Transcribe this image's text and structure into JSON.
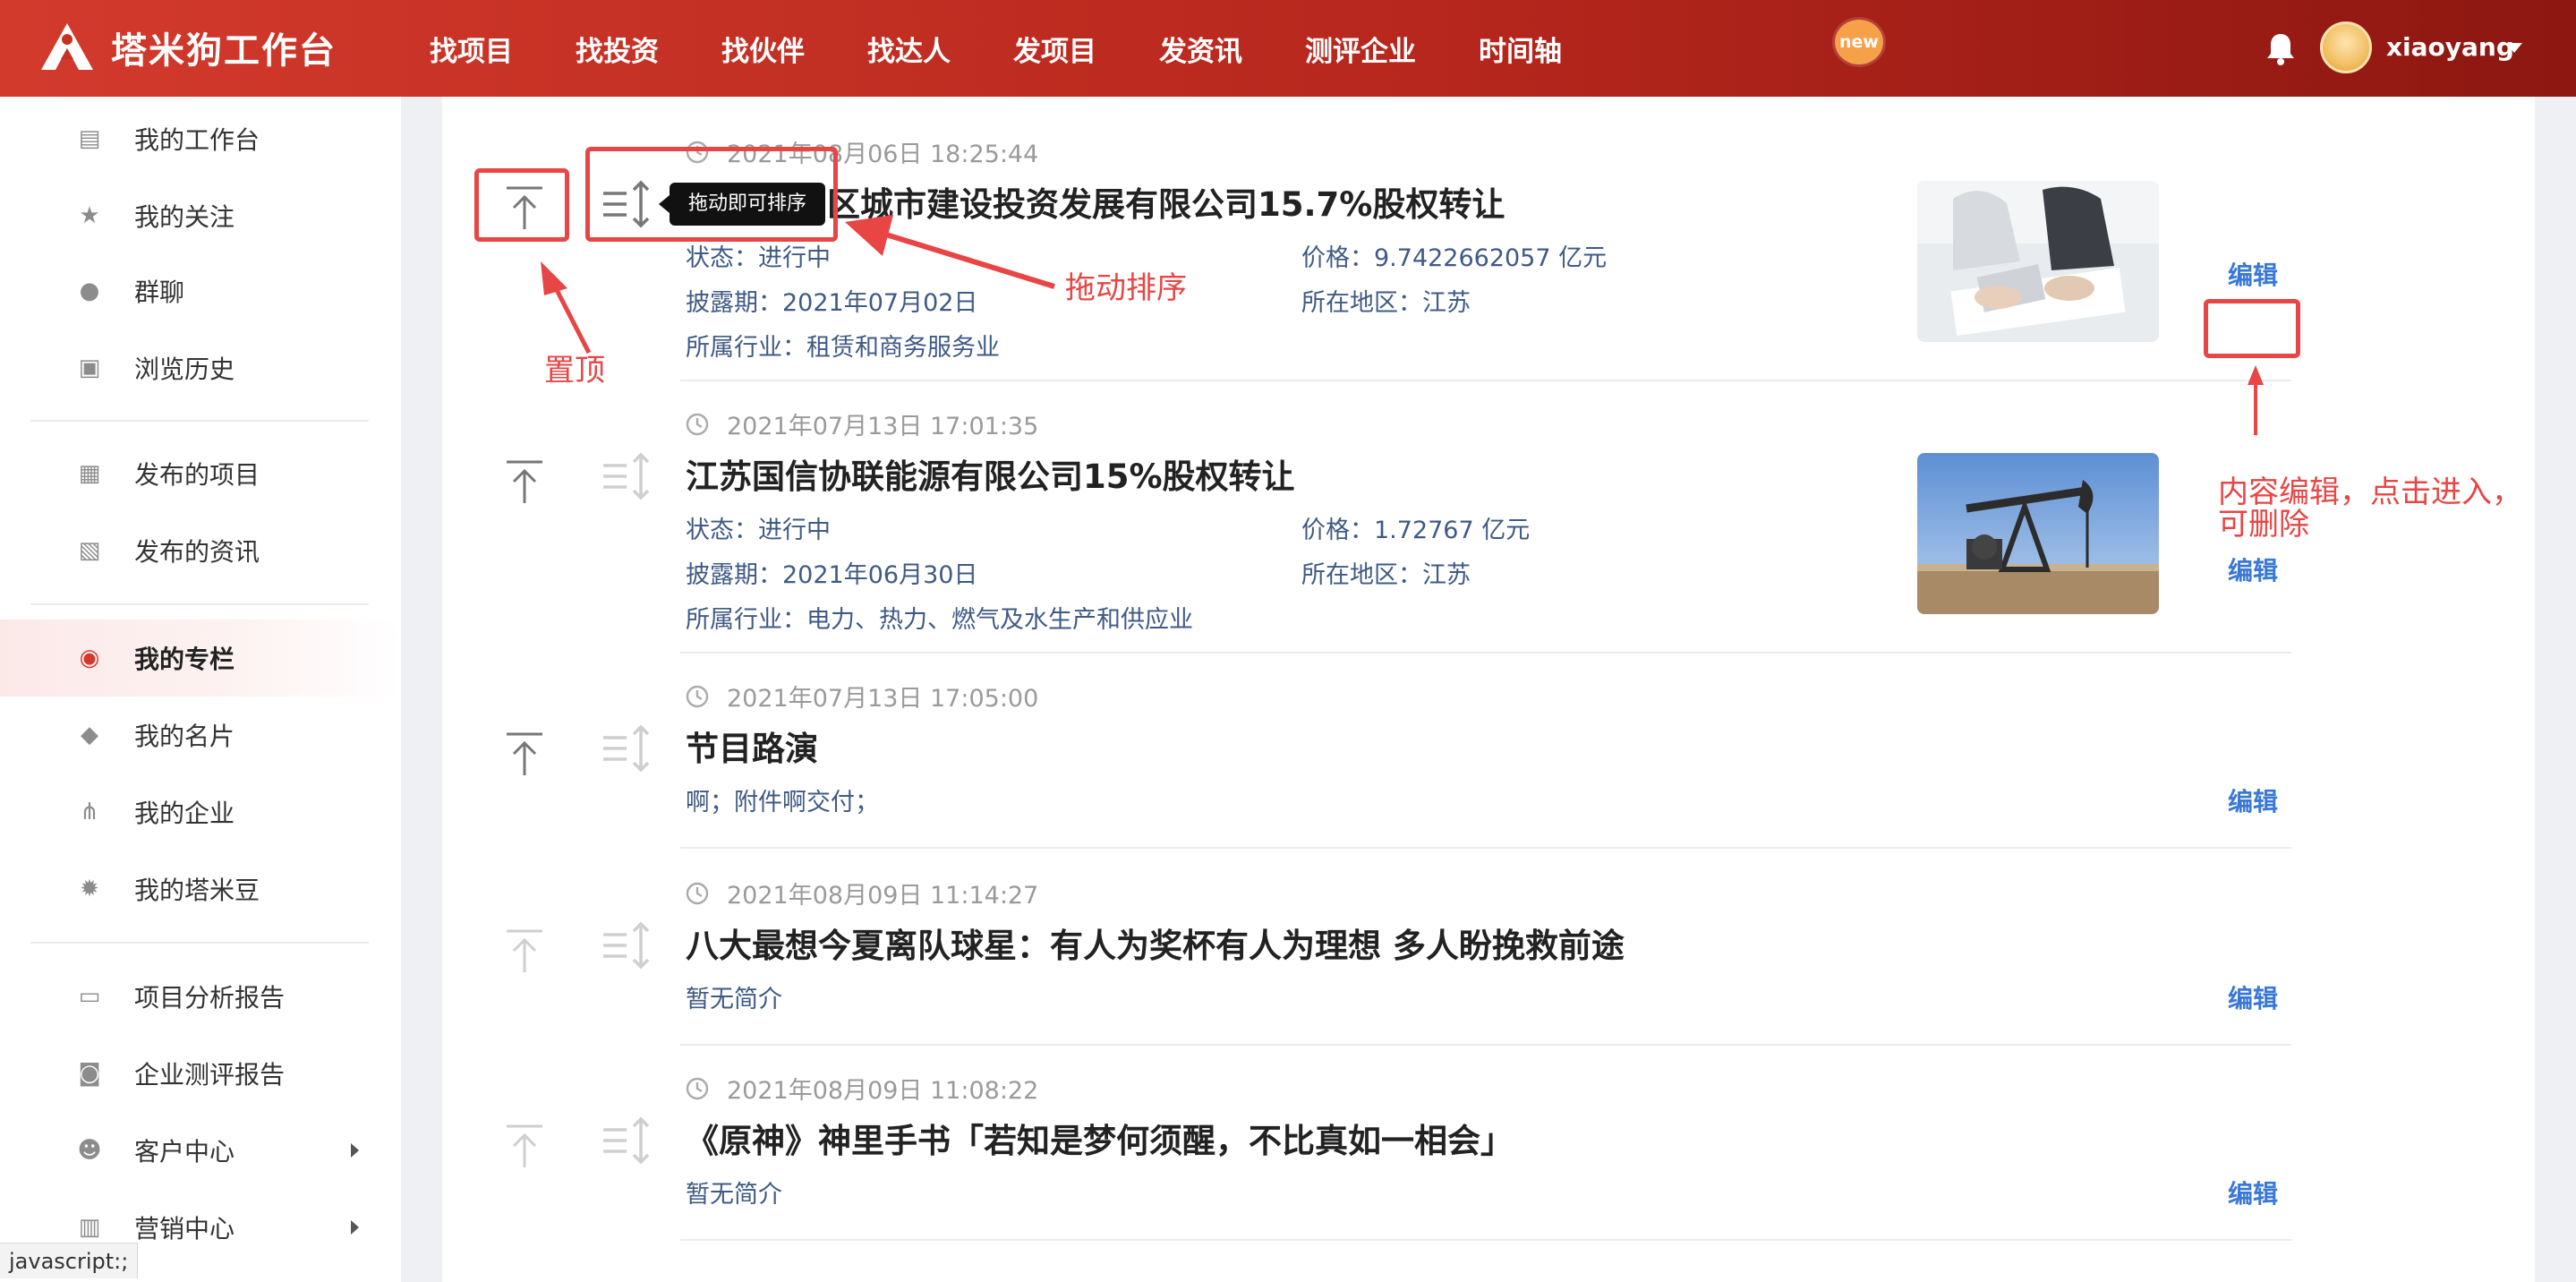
{
  "header": {
    "logo_text": "塔米狗工作台",
    "nav": [
      "找项目",
      "找投资",
      "找伙伴",
      "找达人",
      "发项目",
      "发资讯",
      "测评企业",
      "时间轴"
    ],
    "new_badge": "new",
    "username": "xiaoyang",
    "brand_color": "#c8301f"
  },
  "sidebar": {
    "groups": [
      [
        {
          "label": "我的工作台",
          "icon": "chart-icon"
        },
        {
          "label": "我的关注",
          "icon": "star-icon"
        },
        {
          "label": "群聊",
          "icon": "chat-icon"
        },
        {
          "label": "浏览历史",
          "icon": "history-icon"
        }
      ],
      [
        {
          "label": "发布的项目",
          "icon": "folder-icon"
        },
        {
          "label": "发布的资讯",
          "icon": "news-icon"
        }
      ],
      [
        {
          "label": "我的专栏",
          "icon": "column-icon",
          "active": true
        },
        {
          "label": "我的名片",
          "icon": "tag-icon"
        },
        {
          "label": "我的企业",
          "icon": "org-icon"
        },
        {
          "label": "我的塔米豆",
          "icon": "bean-icon"
        }
      ],
      [
        {
          "label": "项目分析报告",
          "icon": "report-icon"
        },
        {
          "label": "企业测评报告",
          "icon": "search-report-icon"
        },
        {
          "label": "客户中心",
          "icon": "customer-icon",
          "expandable": true
        },
        {
          "label": "营销中心",
          "icon": "marketing-icon",
          "expandable": true
        }
      ]
    ]
  },
  "status_bar": "javascript:;",
  "tooltip": "拖动即可排序",
  "annotations": {
    "pin": "置顶",
    "drag": "拖动排序",
    "edit": "内容编辑，点击进入，",
    "edit_line2": "可删除",
    "color": "#e84545"
  },
  "edit_label": "编辑",
  "items": [
    {
      "time": "2021年08月06日 18:25:44",
      "title": "区城市建设投资发展有限公司15.7%股权转让",
      "status": "状态：进行中",
      "price": "价格：9.7422662057 亿元",
      "disclosure": "披露期：2021年07月02日",
      "region": "所在地区：江苏",
      "industry": "所属行业：租赁和商务服务业",
      "thumb": "business-meeting-photo"
    },
    {
      "time": "2021年07月13日 17:01:35",
      "title": "江苏国信协联能源有限公司15%股权转让",
      "status": "状态：进行中",
      "price": "价格：1.72767 亿元",
      "disclosure": "披露期：2021年06月30日",
      "region": "所在地区：江苏",
      "industry": "所属行业：电力、热力、燃气及水生产和供应业",
      "thumb": "oil-pump-photo"
    },
    {
      "time": "2021年07月13日 17:05:00",
      "title": "节目路演",
      "summary": "啊；附件啊交付；"
    },
    {
      "time": "2021年08月09日 11:14:27",
      "title": "八大最想今夏离队球星：有人为奖杯有人为理想 多人盼挽救前途",
      "summary": "暂无简介"
    },
    {
      "time": "2021年08月09日 11:08:22",
      "title": "《原神》神里手书「若知是梦何须醒，不比真如一相会」",
      "summary": "暂无简介"
    }
  ]
}
